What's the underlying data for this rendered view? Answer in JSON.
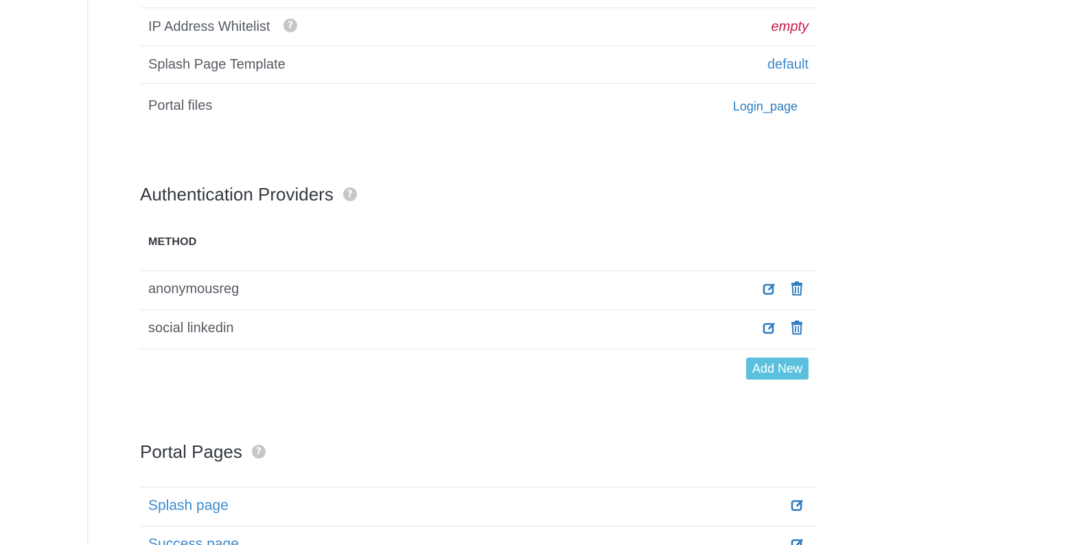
{
  "settings": {
    "rows": [
      {
        "label": "IP Address Whitelist",
        "value": "empty"
      },
      {
        "label": "Splash Page Template",
        "value": "default"
      },
      {
        "label": "Portal files",
        "value": "Login_page"
      }
    ]
  },
  "auth_providers": {
    "title": "Authentication Providers",
    "column_header": "METHOD",
    "rows": [
      {
        "method": "anonymousreg"
      },
      {
        "method": "social linkedin"
      }
    ],
    "add_button_label": "Add New"
  },
  "portal_pages": {
    "title": "Portal Pages",
    "rows": [
      {
        "name": "Splash page"
      },
      {
        "name": "Success page"
      }
    ]
  },
  "icons": {
    "help": "question-circle-icon",
    "edit": "edit-icon",
    "delete": "trash-icon"
  },
  "colors": {
    "link": "#3e8acc",
    "empty_value": "#c9184a",
    "icon_blue": "#2c7bc0",
    "add_button": "#5bc0de",
    "help_icon": "#c7c7c7"
  }
}
